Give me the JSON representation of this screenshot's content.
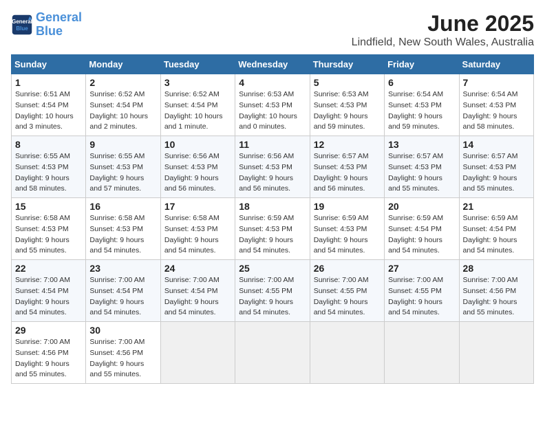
{
  "header": {
    "logo_line1": "General",
    "logo_line2": "Blue",
    "title": "June 2025",
    "subtitle": "Lindfield, New South Wales, Australia"
  },
  "days_of_week": [
    "Sunday",
    "Monday",
    "Tuesday",
    "Wednesday",
    "Thursday",
    "Friday",
    "Saturday"
  ],
  "weeks": [
    [
      {
        "day": 1,
        "sunrise": "6:51 AM",
        "sunset": "4:54 PM",
        "daylight": "10 hours and 3 minutes."
      },
      {
        "day": 2,
        "sunrise": "6:52 AM",
        "sunset": "4:54 PM",
        "daylight": "10 hours and 2 minutes."
      },
      {
        "day": 3,
        "sunrise": "6:52 AM",
        "sunset": "4:54 PM",
        "daylight": "10 hours and 1 minute."
      },
      {
        "day": 4,
        "sunrise": "6:53 AM",
        "sunset": "4:53 PM",
        "daylight": "10 hours and 0 minutes."
      },
      {
        "day": 5,
        "sunrise": "6:53 AM",
        "sunset": "4:53 PM",
        "daylight": "9 hours and 59 minutes."
      },
      {
        "day": 6,
        "sunrise": "6:54 AM",
        "sunset": "4:53 PM",
        "daylight": "9 hours and 59 minutes."
      },
      {
        "day": 7,
        "sunrise": "6:54 AM",
        "sunset": "4:53 PM",
        "daylight": "9 hours and 58 minutes."
      }
    ],
    [
      {
        "day": 8,
        "sunrise": "6:55 AM",
        "sunset": "4:53 PM",
        "daylight": "9 hours and 58 minutes."
      },
      {
        "day": 9,
        "sunrise": "6:55 AM",
        "sunset": "4:53 PM",
        "daylight": "9 hours and 57 minutes."
      },
      {
        "day": 10,
        "sunrise": "6:56 AM",
        "sunset": "4:53 PM",
        "daylight": "9 hours and 56 minutes."
      },
      {
        "day": 11,
        "sunrise": "6:56 AM",
        "sunset": "4:53 PM",
        "daylight": "9 hours and 56 minutes."
      },
      {
        "day": 12,
        "sunrise": "6:57 AM",
        "sunset": "4:53 PM",
        "daylight": "9 hours and 56 minutes."
      },
      {
        "day": 13,
        "sunrise": "6:57 AM",
        "sunset": "4:53 PM",
        "daylight": "9 hours and 55 minutes."
      },
      {
        "day": 14,
        "sunrise": "6:57 AM",
        "sunset": "4:53 PM",
        "daylight": "9 hours and 55 minutes."
      }
    ],
    [
      {
        "day": 15,
        "sunrise": "6:58 AM",
        "sunset": "4:53 PM",
        "daylight": "9 hours and 55 minutes."
      },
      {
        "day": 16,
        "sunrise": "6:58 AM",
        "sunset": "4:53 PM",
        "daylight": "9 hours and 54 minutes."
      },
      {
        "day": 17,
        "sunrise": "6:58 AM",
        "sunset": "4:53 PM",
        "daylight": "9 hours and 54 minutes."
      },
      {
        "day": 18,
        "sunrise": "6:59 AM",
        "sunset": "4:53 PM",
        "daylight": "9 hours and 54 minutes."
      },
      {
        "day": 19,
        "sunrise": "6:59 AM",
        "sunset": "4:53 PM",
        "daylight": "9 hours and 54 minutes."
      },
      {
        "day": 20,
        "sunrise": "6:59 AM",
        "sunset": "4:54 PM",
        "daylight": "9 hours and 54 minutes."
      },
      {
        "day": 21,
        "sunrise": "6:59 AM",
        "sunset": "4:54 PM",
        "daylight": "9 hours and 54 minutes."
      }
    ],
    [
      {
        "day": 22,
        "sunrise": "7:00 AM",
        "sunset": "4:54 PM",
        "daylight": "9 hours and 54 minutes."
      },
      {
        "day": 23,
        "sunrise": "7:00 AM",
        "sunset": "4:54 PM",
        "daylight": "9 hours and 54 minutes."
      },
      {
        "day": 24,
        "sunrise": "7:00 AM",
        "sunset": "4:54 PM",
        "daylight": "9 hours and 54 minutes."
      },
      {
        "day": 25,
        "sunrise": "7:00 AM",
        "sunset": "4:55 PM",
        "daylight": "9 hours and 54 minutes."
      },
      {
        "day": 26,
        "sunrise": "7:00 AM",
        "sunset": "4:55 PM",
        "daylight": "9 hours and 54 minutes."
      },
      {
        "day": 27,
        "sunrise": "7:00 AM",
        "sunset": "4:55 PM",
        "daylight": "9 hours and 54 minutes."
      },
      {
        "day": 28,
        "sunrise": "7:00 AM",
        "sunset": "4:56 PM",
        "daylight": "9 hours and 55 minutes."
      }
    ],
    [
      {
        "day": 29,
        "sunrise": "7:00 AM",
        "sunset": "4:56 PM",
        "daylight": "9 hours and 55 minutes."
      },
      {
        "day": 30,
        "sunrise": "7:00 AM",
        "sunset": "4:56 PM",
        "daylight": "9 hours and 55 minutes."
      },
      null,
      null,
      null,
      null,
      null
    ]
  ],
  "labels": {
    "sunrise": "Sunrise:",
    "sunset": "Sunset:",
    "daylight": "Daylight:"
  }
}
